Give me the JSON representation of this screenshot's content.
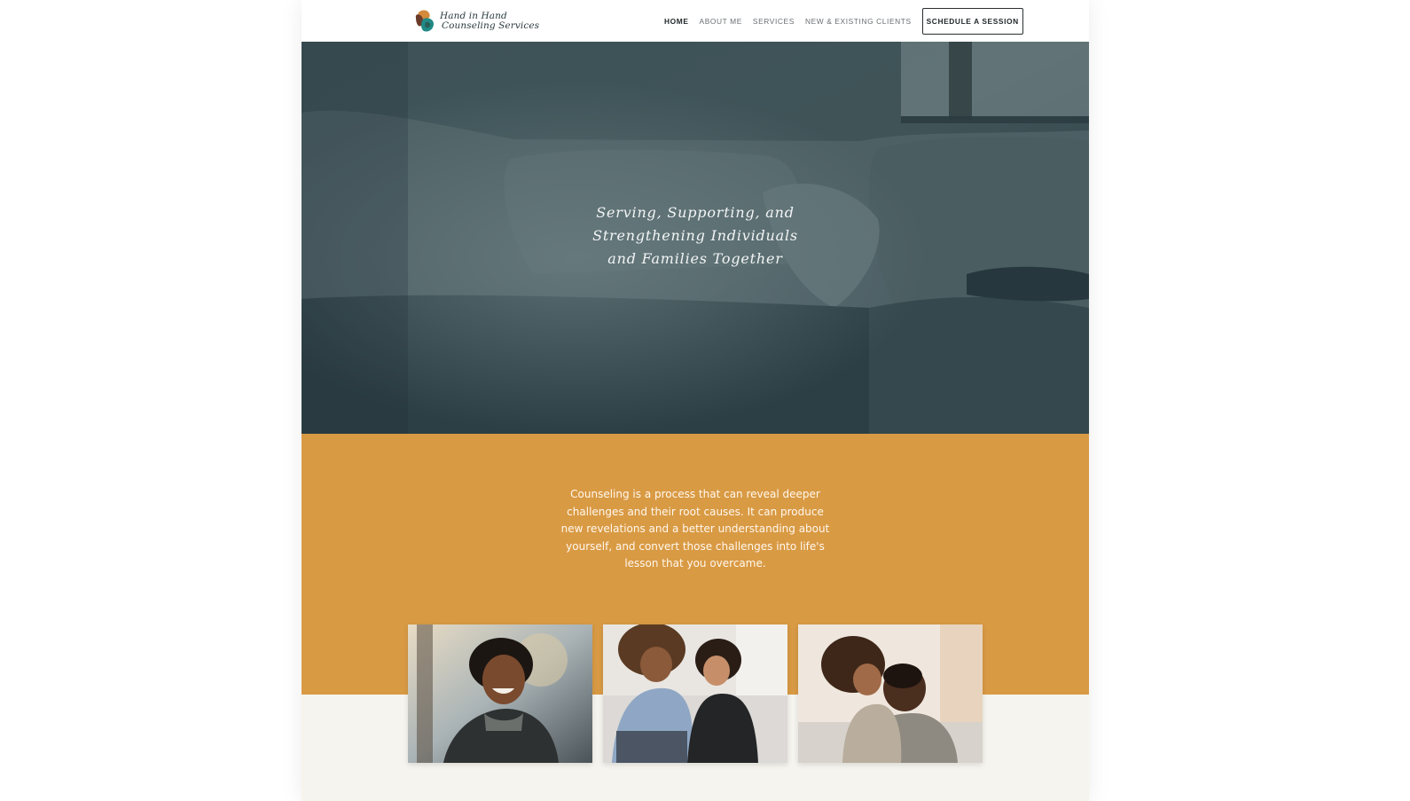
{
  "header": {
    "logo": {
      "line1": "Hand in Hand",
      "line2": "Counseling Services"
    },
    "nav": [
      {
        "label": "HOME",
        "active": true
      },
      {
        "label": "ABOUT ME",
        "active": false
      },
      {
        "label": "SERVICES",
        "active": false
      },
      {
        "label": "NEW & EXISTING CLIENTS",
        "active": false
      }
    ],
    "cta_label": "SCHEDULE A SESSION"
  },
  "hero": {
    "line1": "Serving, Supporting, and",
    "line2": "Strengthening Individuals",
    "line3": "and Families Together"
  },
  "intro": {
    "text": "Counseling is a process that can reveal deeper challenges and their root causes. It can produce new revelations and a better understanding about yourself, and convert those challenges into life's lesson that you overcame."
  },
  "colors": {
    "accent_orange": "#d99a44",
    "hero_teal": "#33474d",
    "page_bg": "#f6f4ee"
  }
}
